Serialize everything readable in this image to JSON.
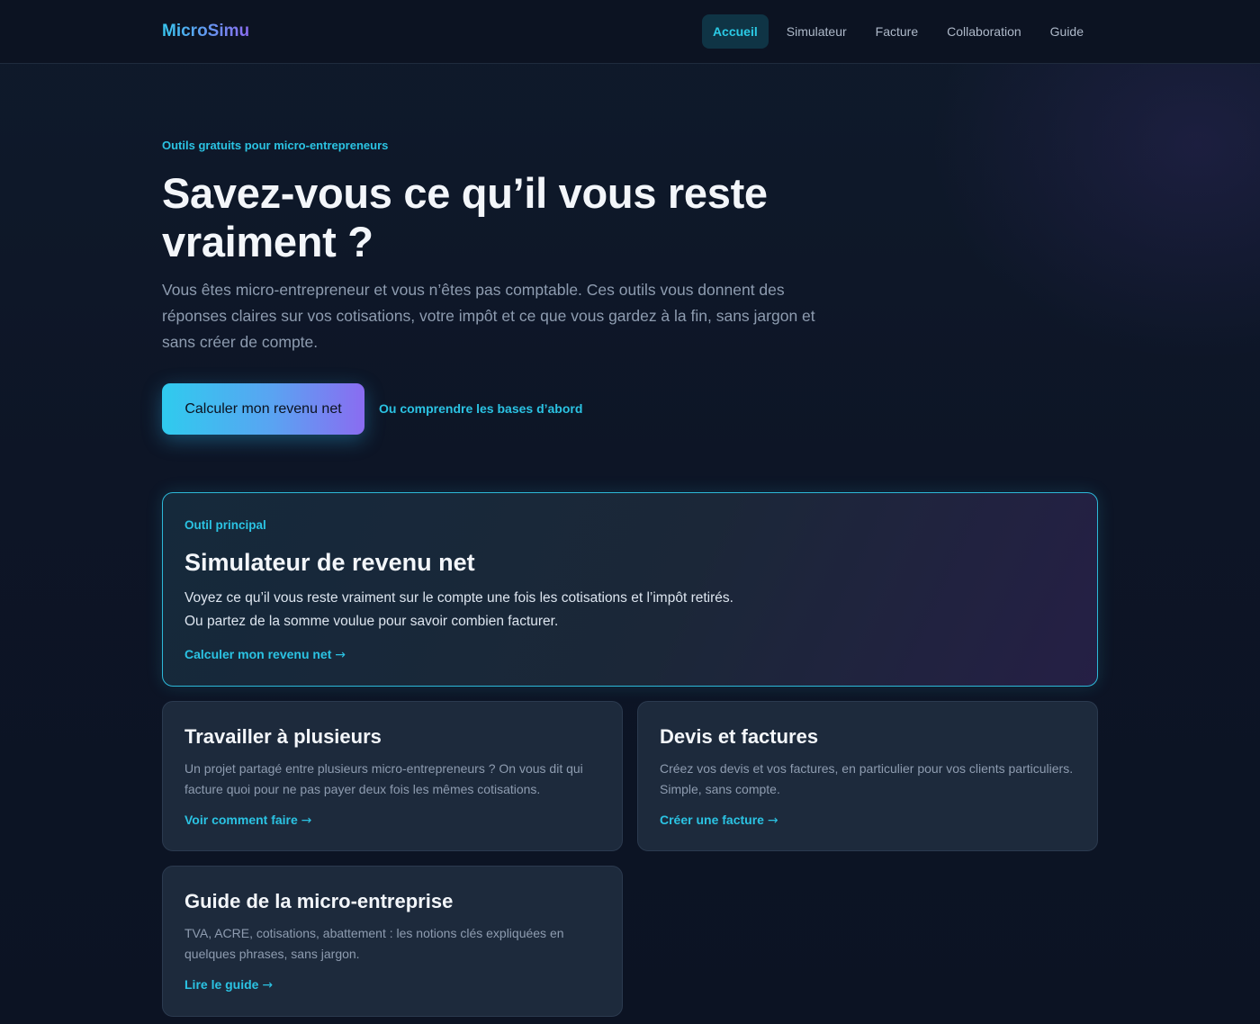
{
  "header": {
    "logo": "MicroSimu",
    "nav": [
      {
        "label": "Accueil",
        "active": true
      },
      {
        "label": "Simulateur",
        "active": false
      },
      {
        "label": "Facture",
        "active": false
      },
      {
        "label": "Collaboration",
        "active": false
      },
      {
        "label": "Guide",
        "active": false
      }
    ]
  },
  "hero": {
    "eyebrow": "Outils gratuits pour micro-entrepreneurs",
    "title": "Savez-vous ce qu’il vous reste vraiment ?",
    "lead": "Vous êtes micro-entrepreneur et vous n’êtes pas comptable. Ces outils vous donnent des réponses claires sur vos cotisations, votre impôt et ce que vous gardez à la fin, sans jargon et sans créer de compte.",
    "cta_label": "Calculer mon revenu net",
    "secondary_link": "Ou comprendre les bases d’abord"
  },
  "main_card": {
    "tag": "Outil principal",
    "title": "Simulateur de revenu net",
    "desc_line1": "Voyez ce qu’il vous reste vraiment sur le compte une fois les cotisations et l’impôt retirés.",
    "desc_line2": "Ou partez de la somme voulue pour savoir combien facturer.",
    "link": "Calculer mon revenu net",
    "arrow": "→"
  },
  "cards": {
    "collab": {
      "title": "Travailler à plusieurs",
      "desc": "Un projet partagé entre plusieurs micro-entrepreneurs ? On vous dit qui facture quoi pour ne pas payer deux fois les mêmes cotisations.",
      "link": "Voir comment faire",
      "arrow": "→"
    },
    "invoice": {
      "title": "Devis et factures",
      "desc": "Créez vos devis et vos factures, en particulier pour vos clients particuliers. Simple, sans compte.",
      "link": "Créer une facture",
      "arrow": "→"
    },
    "guide": {
      "title": "Guide de la micro-entreprise",
      "desc": "TVA, ACRE, cotisations, abattement : les notions clés expliquées en quelques phrases, sans jargon.",
      "link": "Lire le guide",
      "arrow": "→"
    }
  },
  "colors": {
    "background": "#0d1424",
    "accent": "#2bc3e3",
    "accent_purple": "#8a6cf1",
    "card": "#1d2a3c"
  }
}
